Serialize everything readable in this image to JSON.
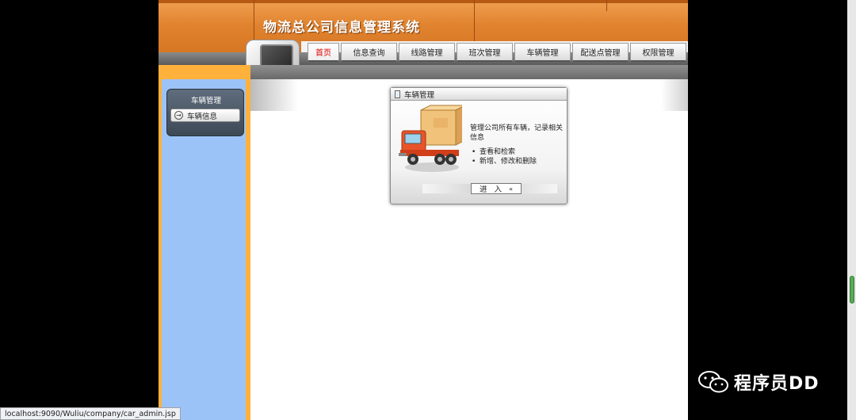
{
  "app": {
    "title": "物流总公司信息管理系统"
  },
  "nav": {
    "tabs": [
      "首页",
      "信息查询",
      "线路管理",
      "班次管理",
      "车辆管理",
      "配送点管理",
      "权限管理"
    ],
    "active_index": 0
  },
  "sidebar": {
    "title": "车辆管理",
    "items": [
      {
        "label": "车辆信息"
      }
    ]
  },
  "panel": {
    "title": "车辆管理",
    "description": "管理公司所有车辆，记录相关信息",
    "bullets": [
      "查看和检索",
      "新增、修改和删除"
    ],
    "enter_label": "进 入",
    "enter_chevron": "«"
  },
  "statusbar": {
    "url": "localhost:9090/Wuliu/company/car_admin.jsp"
  },
  "watermark": {
    "text": "程序员DD",
    "icon": "wechat-icon"
  },
  "colors": {
    "header_orange": "#e0822e",
    "sidebar_blue": "#9cc3f8",
    "stripe_orange": "#ffb13b",
    "active_tab_text": "#dd0000"
  }
}
